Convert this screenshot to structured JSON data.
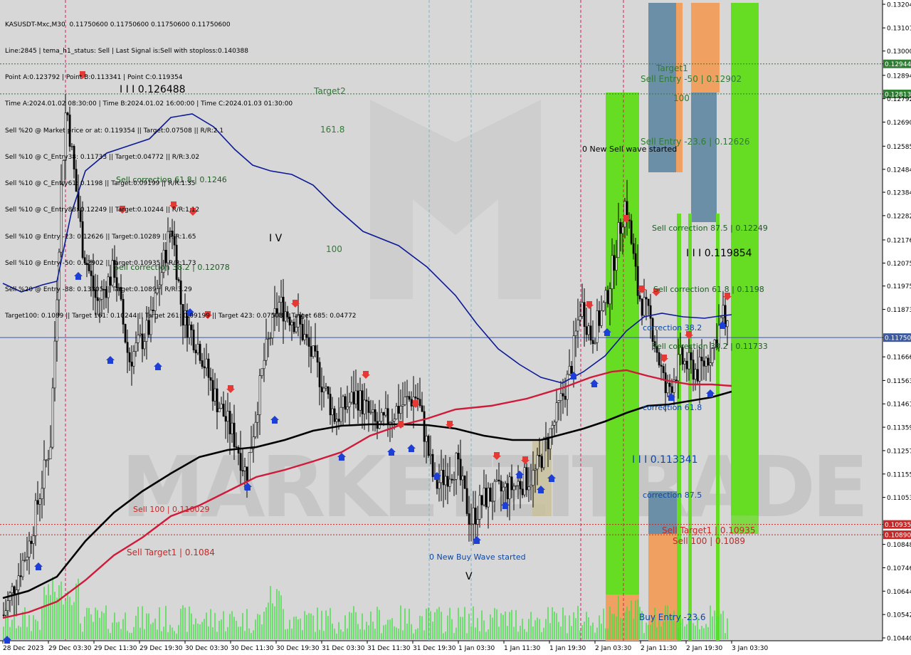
{
  "info_lines": [
    "KASUSDT-Mxc,M30  0.11750600 0.11750600 0.11750600 0.11750600",
    "Line:2845 | tema_h1_status: Sell | Last Signal is:Sell with stoploss:0.140388",
    "Point A:0.123792 | Point B:0.113341 | Point C:0.119354",
    "Time A:2024.01.02 08:30:00 | Time B:2024.01.02 16:00:00 | Time C:2024.01.03 01:30:00",
    "Sell %20 @ Market price or at: 0.119354 || Target:0.07508 || R/R:2.1",
    "Sell %10 @ C_Entry38: 0.11733 || Target:0.04772 || R/R:3.02",
    "Sell %10 @ C_Entry61: 0.1198 || Target:0.09199 || R/R:1.35",
    "Sell %10 @ C_Entry88: 0.12249 || Target:0.10244 || R/R:1.12",
    "Sell %10 @ Entry -23: 0.12626 || Target:0.10289 || R/R:1.65",
    "Sell %10 @ Entry -50: 0.12902 || Target:0.10935 || R/R:1.73",
    "Sell %20 @ Entry -88: 0.13305 || Target:0.1089 || R/R:3.29",
    "Target100: 0.1089 || Target 161: 0.10244 || Target 261: 0.09199 || Target 423: 0.07508 || Target 685: 0.04772"
  ],
  "price_axis": [
    "0.13204",
    "0.13101",
    "0.13000",
    "0.12944",
    "0.12894",
    "0.12813",
    "0.12792",
    "0.12690",
    "0.12585",
    "0.12484",
    "0.12384",
    "0.12282",
    "0.12176",
    "0.12075",
    "0.11975",
    "0.11873",
    "0.11750",
    "0.11666",
    "0.11563",
    "0.11461",
    "0.11359",
    "0.11257",
    "0.11155",
    "0.11053",
    "0.10935",
    "0.10890",
    "0.10848",
    "0.10746",
    "0.10644",
    "0.10542",
    "0.10440"
  ],
  "time_axis": [
    "28 Dec 2023",
    "29 Dec 03:30",
    "29 Dec 11:30",
    "29 Dec 19:30",
    "30 Dec 03:30",
    "30 Dec 11:30",
    "30 Dec 19:30",
    "31 Dec 03:30",
    "31 Dec 11:30",
    "31 Dec 19:30",
    "1 Jan 03:30",
    "1 Jan 11:30",
    "1 Jan 19:30",
    "2 Jan 03:30",
    "2 Jan 11:30",
    "2 Jan 19:30",
    "3 Jan 03:30"
  ],
  "highlight_prices": {
    "current": "0.11750",
    "target1_line": "0.12944",
    "target2_line": "0.12813",
    "sell_target1": "0.10935",
    "sell_100": "0.10890"
  },
  "labels": {
    "target1": "Target1",
    "target2": "Target2",
    "t161": "161.8",
    "t100a": "100",
    "t100b": "100",
    "sell_entry_50": "Sell Entry -50 | 0.12902",
    "sell_entry_23": "Sell Entry -23.6 | 0.12626",
    "new_sell_wave": "0 New Sell wave started",
    "sell_corr_875": "Sell correction 87.5 | 0.12249",
    "wave_iii_c": "I I I 0.119854",
    "sell_corr_618_right": "Sell correction 61.8 | 0.1198",
    "corr_382_right": "correction 38.2",
    "sell_corr_382_right": "Sell correction 38.2 | 0.11733",
    "corr_618_right": "correction 61.8",
    "wave_iii_b": "I I I 0.113341",
    "corr_875_right": "correction 87.5",
    "sell_target1_right": "Sell Target1 | 0.10935",
    "sell_100_right": "Sell 100 | 0.1089",
    "buy_entry": "Buy Entry -23.6",
    "wave_iii_a": "I I I 0.126488",
    "sell_corr_618_left": "Sell correction 61.8 | 0.1246",
    "sell_corr_382_left": "Sell correction 38.2 | 0.12078",
    "wave_iv": "I V",
    "t100_mid": "100",
    "sell_1100": "Sell 100 | 0.110029",
    "sell_target1_left": "Sell Target1 | 0.1084",
    "new_buy_wave": "0 New Buy Wave started",
    "wave_v": "V",
    "watermark": "MARKETZITRADE"
  },
  "colors": {
    "background": "#d7d7d7",
    "axis_bg": "#ffffff",
    "bull": "#000000",
    "bear": "#000000",
    "ma_blue": "#0c1a96",
    "ma_red": "#d01a3a",
    "ma_black": "#000000",
    "green_zone": "#66dd22",
    "orange_zone": "#f0a060",
    "slate_zone": "#6a8fa6",
    "volume": "#44dd44",
    "current_line": "#3d5a9e",
    "dotted_green": "#2e7d32",
    "dotted_red": "#c62828",
    "magenta_vline": "#d81b60",
    "cyan_vline": "#7fb5c0"
  }
}
